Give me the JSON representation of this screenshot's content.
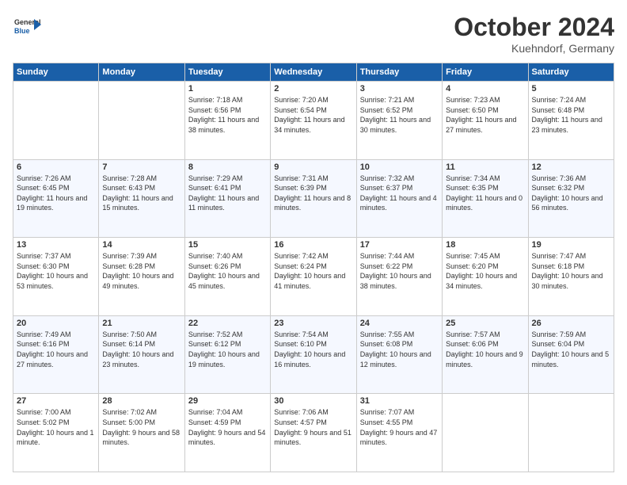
{
  "header": {
    "logo_line1": "General",
    "logo_line2": "Blue",
    "month": "October 2024",
    "location": "Kuehndorf, Germany"
  },
  "weekdays": [
    "Sunday",
    "Monday",
    "Tuesday",
    "Wednesday",
    "Thursday",
    "Friday",
    "Saturday"
  ],
  "weeks": [
    [
      {
        "day": "",
        "info": ""
      },
      {
        "day": "",
        "info": ""
      },
      {
        "day": "1",
        "info": "Sunrise: 7:18 AM\nSunset: 6:56 PM\nDaylight: 11 hours and 38 minutes."
      },
      {
        "day": "2",
        "info": "Sunrise: 7:20 AM\nSunset: 6:54 PM\nDaylight: 11 hours and 34 minutes."
      },
      {
        "day": "3",
        "info": "Sunrise: 7:21 AM\nSunset: 6:52 PM\nDaylight: 11 hours and 30 minutes."
      },
      {
        "day": "4",
        "info": "Sunrise: 7:23 AM\nSunset: 6:50 PM\nDaylight: 11 hours and 27 minutes."
      },
      {
        "day": "5",
        "info": "Sunrise: 7:24 AM\nSunset: 6:48 PM\nDaylight: 11 hours and 23 minutes."
      }
    ],
    [
      {
        "day": "6",
        "info": "Sunrise: 7:26 AM\nSunset: 6:45 PM\nDaylight: 11 hours and 19 minutes."
      },
      {
        "day": "7",
        "info": "Sunrise: 7:28 AM\nSunset: 6:43 PM\nDaylight: 11 hours and 15 minutes."
      },
      {
        "day": "8",
        "info": "Sunrise: 7:29 AM\nSunset: 6:41 PM\nDaylight: 11 hours and 11 minutes."
      },
      {
        "day": "9",
        "info": "Sunrise: 7:31 AM\nSunset: 6:39 PM\nDaylight: 11 hours and 8 minutes."
      },
      {
        "day": "10",
        "info": "Sunrise: 7:32 AM\nSunset: 6:37 PM\nDaylight: 11 hours and 4 minutes."
      },
      {
        "day": "11",
        "info": "Sunrise: 7:34 AM\nSunset: 6:35 PM\nDaylight: 11 hours and 0 minutes."
      },
      {
        "day": "12",
        "info": "Sunrise: 7:36 AM\nSunset: 6:32 PM\nDaylight: 10 hours and 56 minutes."
      }
    ],
    [
      {
        "day": "13",
        "info": "Sunrise: 7:37 AM\nSunset: 6:30 PM\nDaylight: 10 hours and 53 minutes."
      },
      {
        "day": "14",
        "info": "Sunrise: 7:39 AM\nSunset: 6:28 PM\nDaylight: 10 hours and 49 minutes."
      },
      {
        "day": "15",
        "info": "Sunrise: 7:40 AM\nSunset: 6:26 PM\nDaylight: 10 hours and 45 minutes."
      },
      {
        "day": "16",
        "info": "Sunrise: 7:42 AM\nSunset: 6:24 PM\nDaylight: 10 hours and 41 minutes."
      },
      {
        "day": "17",
        "info": "Sunrise: 7:44 AM\nSunset: 6:22 PM\nDaylight: 10 hours and 38 minutes."
      },
      {
        "day": "18",
        "info": "Sunrise: 7:45 AM\nSunset: 6:20 PM\nDaylight: 10 hours and 34 minutes."
      },
      {
        "day": "19",
        "info": "Sunrise: 7:47 AM\nSunset: 6:18 PM\nDaylight: 10 hours and 30 minutes."
      }
    ],
    [
      {
        "day": "20",
        "info": "Sunrise: 7:49 AM\nSunset: 6:16 PM\nDaylight: 10 hours and 27 minutes."
      },
      {
        "day": "21",
        "info": "Sunrise: 7:50 AM\nSunset: 6:14 PM\nDaylight: 10 hours and 23 minutes."
      },
      {
        "day": "22",
        "info": "Sunrise: 7:52 AM\nSunset: 6:12 PM\nDaylight: 10 hours and 19 minutes."
      },
      {
        "day": "23",
        "info": "Sunrise: 7:54 AM\nSunset: 6:10 PM\nDaylight: 10 hours and 16 minutes."
      },
      {
        "day": "24",
        "info": "Sunrise: 7:55 AM\nSunset: 6:08 PM\nDaylight: 10 hours and 12 minutes."
      },
      {
        "day": "25",
        "info": "Sunrise: 7:57 AM\nSunset: 6:06 PM\nDaylight: 10 hours and 9 minutes."
      },
      {
        "day": "26",
        "info": "Sunrise: 7:59 AM\nSunset: 6:04 PM\nDaylight: 10 hours and 5 minutes."
      }
    ],
    [
      {
        "day": "27",
        "info": "Sunrise: 7:00 AM\nSunset: 5:02 PM\nDaylight: 10 hours and 1 minute."
      },
      {
        "day": "28",
        "info": "Sunrise: 7:02 AM\nSunset: 5:00 PM\nDaylight: 9 hours and 58 minutes."
      },
      {
        "day": "29",
        "info": "Sunrise: 7:04 AM\nSunset: 4:59 PM\nDaylight: 9 hours and 54 minutes."
      },
      {
        "day": "30",
        "info": "Sunrise: 7:06 AM\nSunset: 4:57 PM\nDaylight: 9 hours and 51 minutes."
      },
      {
        "day": "31",
        "info": "Sunrise: 7:07 AM\nSunset: 4:55 PM\nDaylight: 9 hours and 47 minutes."
      },
      {
        "day": "",
        "info": ""
      },
      {
        "day": "",
        "info": ""
      }
    ]
  ]
}
